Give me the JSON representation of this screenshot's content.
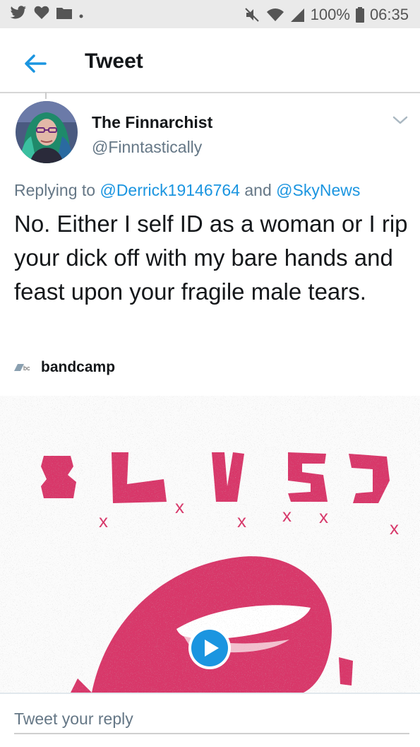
{
  "status_bar": {
    "battery": "100%",
    "time": "06:35",
    "left_icons": [
      "twitter-icon",
      "heart-icon",
      "folder-icon",
      "dot-icon"
    ],
    "right_icons": [
      "mute-icon",
      "wifi-icon",
      "signal-icon",
      "battery-icon"
    ]
  },
  "header": {
    "title": "Tweet",
    "back_icon": "back-arrow-icon"
  },
  "tweet": {
    "author_name": "The Finnarchist",
    "author_handle": "@Finntastically",
    "replying_prefix": "Replying to",
    "mention_1": "@Derrick19146764",
    "conjunction": "and",
    "mention_2": "@SkyNews",
    "text": "No. Either I self ID as a woman or I rip your dick off with my bare hands and feast upon your fragile male tears.",
    "card_source": "bandcamp",
    "card_logo_text": "bc",
    "media_glyphs": [
      "x",
      "x",
      "x",
      "x",
      "x",
      "x"
    ]
  },
  "reply": {
    "placeholder": "Tweet your reply"
  },
  "colors": {
    "accent": "#1b95e0",
    "muted_text": "#657786",
    "media_pink": "#d8386a",
    "status_bar_bg": "#eaeaea"
  }
}
